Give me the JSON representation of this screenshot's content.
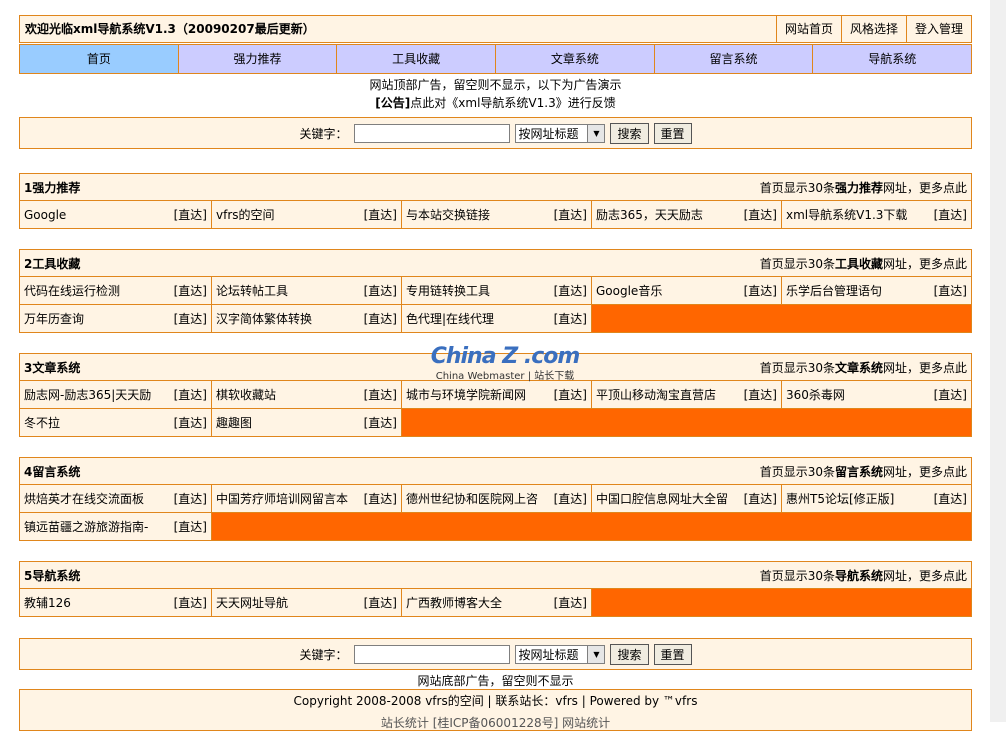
{
  "header": {
    "title": "欢迎光临xml导航系统V1.3（20090207最后更新）",
    "links": [
      "网站首页",
      "风格选择",
      "登入管理"
    ]
  },
  "nav": [
    "首页",
    "强力推荐",
    "工具收藏",
    "文章系统",
    "留言系统",
    "导航系统"
  ],
  "top_ad": "网站顶部广告，留空则不显示，以下为广告演示",
  "notice_label": "[公告]",
  "notice_text": "点此对《xml导航系统V1.3》进行反馈",
  "search": {
    "label": "关键字：",
    "value": "",
    "select_value": "按网址标题",
    "search_btn": "搜索",
    "reset_btn": "重置"
  },
  "go_label": "[直达]",
  "more_prefix": "首页显示30条",
  "more_suffix": "网址，更多点此",
  "sections": [
    {
      "title": "1强力推荐",
      "name": "强力推荐",
      "rows": [
        [
          "Google",
          "vfrs的空间",
          "与本站交换链接",
          "励志365，天天励志",
          "xml导航系统V1.3下载"
        ]
      ]
    },
    {
      "title": "2工具收藏",
      "name": "工具收藏",
      "rows": [
        [
          "代码在线运行检测",
          "论坛转帖工具",
          "专用链转换工具",
          "Google音乐",
          "乐学后台管理语句"
        ],
        [
          "万年历查询",
          "汉字简体繁体转换",
          "色代理|在线代理"
        ]
      ]
    },
    {
      "title": "3文章系统",
      "name": "文章系统",
      "rows": [
        [
          "励志网-励志365|天天励",
          "棋软收藏站",
          "城市与环境学院新闻网",
          "平顶山移动淘宝直营店",
          "360杀毒网"
        ],
        [
          "冬不拉",
          "趣趣图"
        ]
      ]
    },
    {
      "title": "4留言系统",
      "name": "留言系统",
      "rows": [
        [
          "烘焙英才在线交流面板",
          "中国芳疗师培训网留言本",
          "德州世纪协和医院网上咨",
          "中国口腔信息网址大全留",
          "惠州T5论坛[修正版]"
        ],
        [
          "镇远苗疆之游旅游指南-"
        ]
      ]
    },
    {
      "title": "5导航系统",
      "name": "导航系统",
      "rows": [
        [
          "教辅126",
          "天天网址导航",
          "广西教师博客大全"
        ]
      ]
    }
  ],
  "bottom_ad": "网站底部广告，留空则不显示",
  "copyright": "Copyright 2008-2008 vfrs的空间 | 联系站长：vfrs | Powered by ™vfrs",
  "stats": "站长统计 [桂ICP备06001228号] 网站统计",
  "watermark": {
    "logo": "China Z .com",
    "subtitle": "China Webmaster | 站长下载"
  }
}
